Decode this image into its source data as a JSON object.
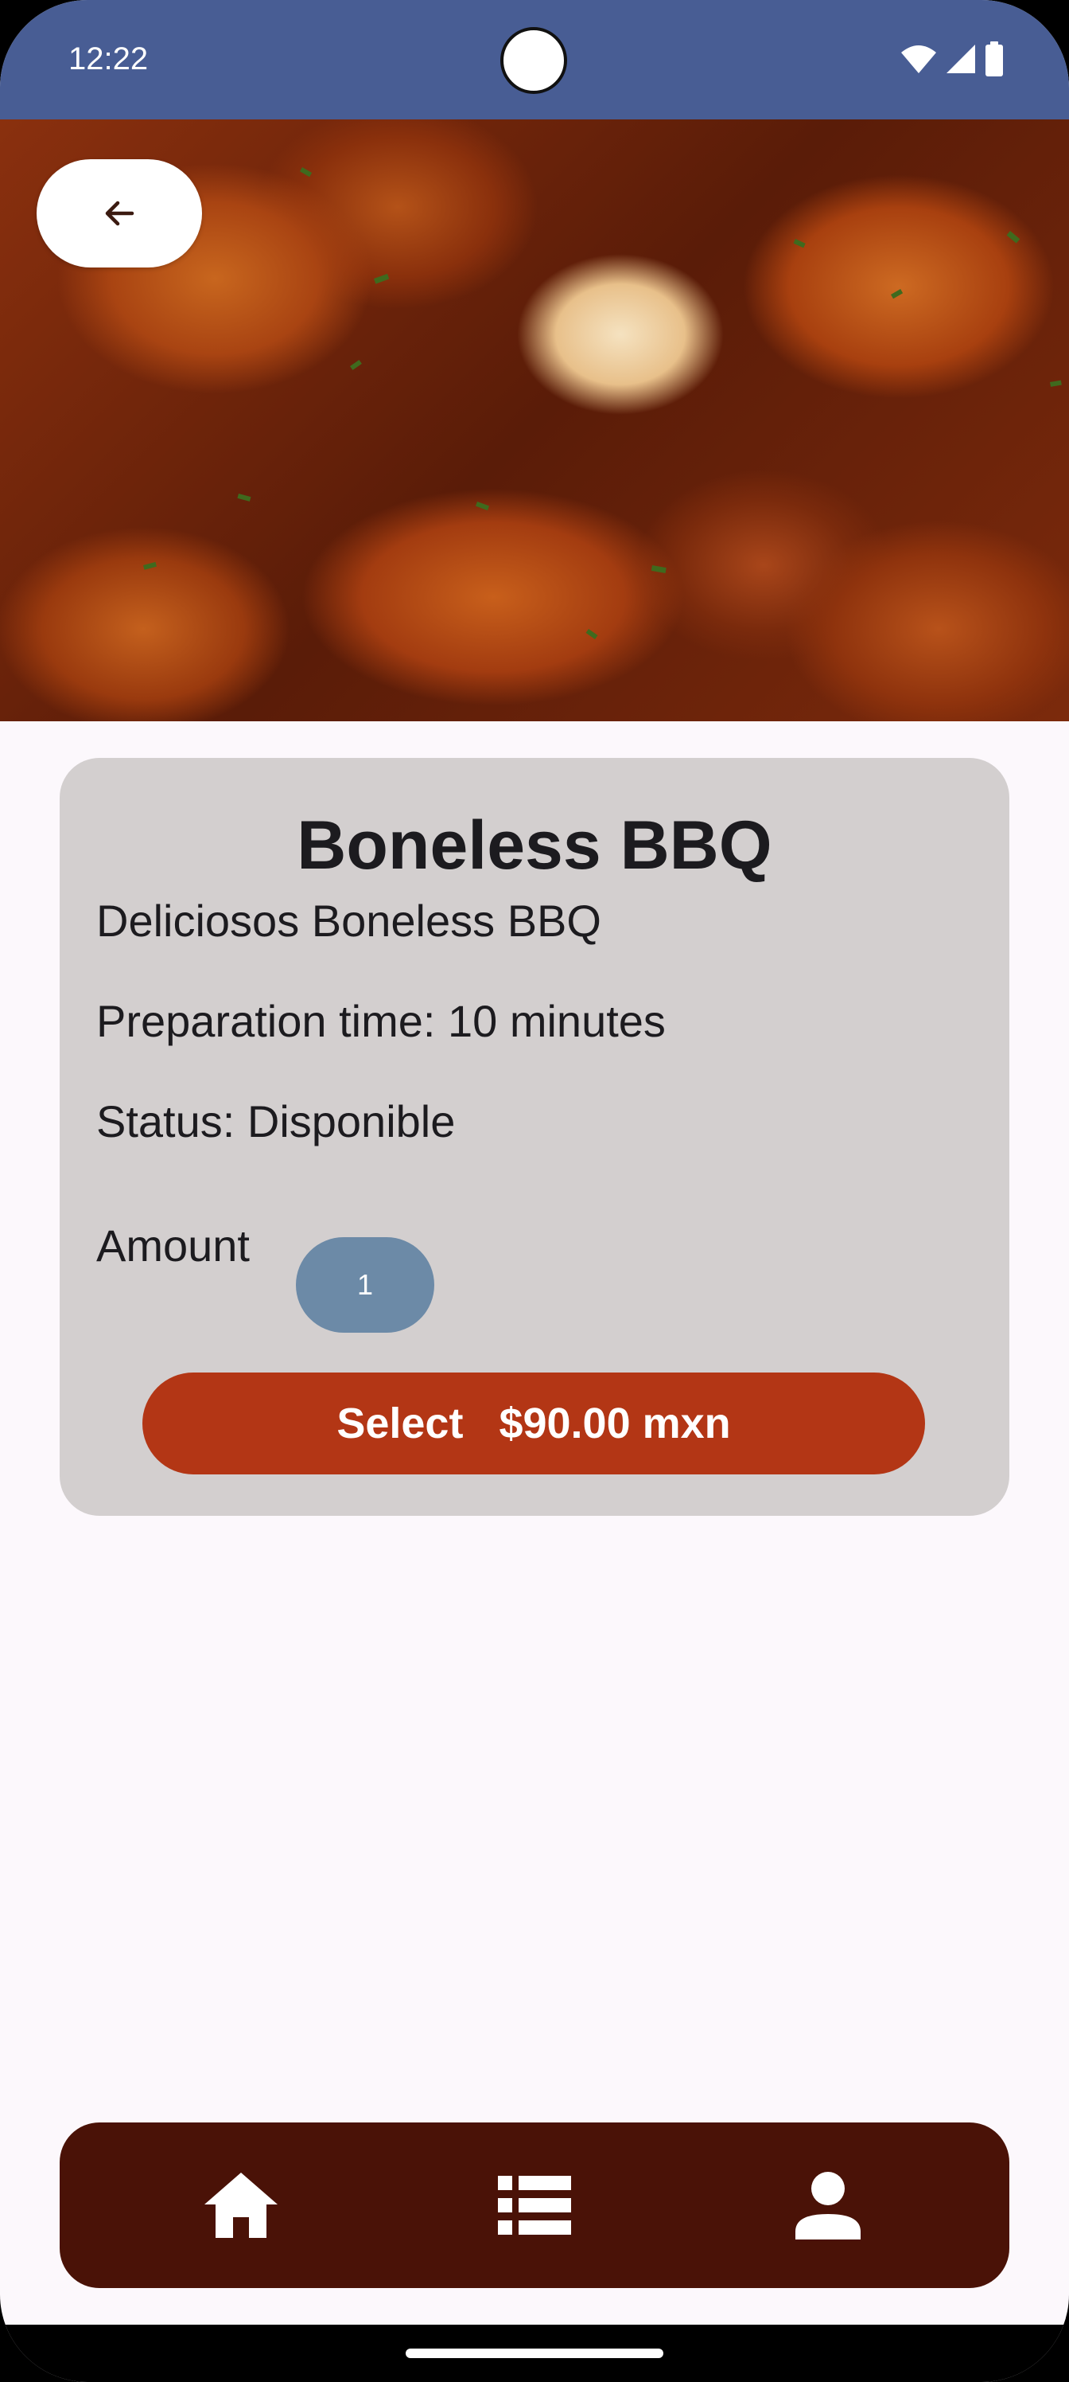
{
  "status_bar": {
    "time": "12:22",
    "icons": [
      "wifi-icon",
      "signal-icon",
      "battery-icon"
    ],
    "background": "#485d94"
  },
  "hero": {
    "image": "boneless-bbq-photo",
    "back_icon": "arrow-left-icon"
  },
  "product": {
    "title": "Boneless BBQ",
    "description": "Deliciosos Boneless BBQ",
    "preparation": "Preparation time: 10 minutes",
    "status": "Status: Disponible",
    "amount_label": "Amount",
    "amount_value": "1",
    "select_label": "Select   $90.00 mxn"
  },
  "bottom_nav": {
    "items": [
      {
        "id": "home",
        "icon": "home-icon"
      },
      {
        "id": "orders",
        "icon": "list-icon"
      },
      {
        "id": "profile",
        "icon": "person-icon"
      }
    ]
  },
  "colors": {
    "card": "#d3cfcf",
    "accent": "#b33615",
    "amount_pill": "#6c8aa7",
    "nav": "#4a1207",
    "page_background": "#fcf8fc"
  }
}
